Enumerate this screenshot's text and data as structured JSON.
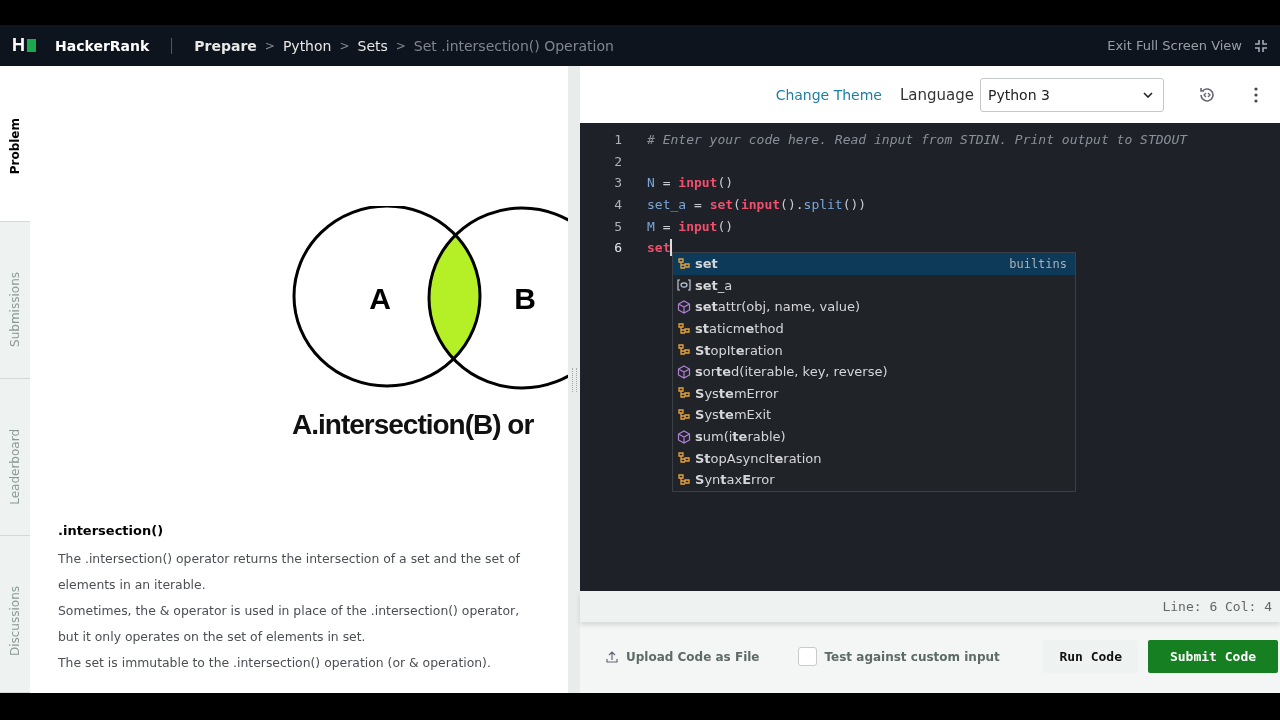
{
  "header": {
    "logo": "H",
    "brand": "HackerRank",
    "breadcrumbs": [
      {
        "label": "Prepare",
        "current": false,
        "strong": true
      },
      {
        "label": "Python",
        "current": false,
        "strong": false
      },
      {
        "label": "Sets",
        "current": false,
        "strong": false
      },
      {
        "label": "Set .intersection() Operation",
        "current": true,
        "strong": false
      }
    ],
    "separator": ">",
    "exit": "Exit Full Screen View"
  },
  "side_tabs": [
    {
      "label": "Problem",
      "selected": true
    },
    {
      "label": "Submissions",
      "selected": false
    },
    {
      "label": "Leaderboard",
      "selected": false
    },
    {
      "label": "Discussions",
      "selected": false
    }
  ],
  "problem": {
    "figure": {
      "left_label": "A",
      "right_label": "B",
      "caption": "A.intersection(B) or"
    },
    "heading": ".intersection()",
    "paragraphs": [
      "The .intersection() operator returns the intersection of a set and the set of elements in an iterable.",
      "Sometimes, the & operator is used in place of the .intersection() operator, but it only operates on the set of elements in set.",
      "The set is immutable to the .intersection() operation (or & operation)."
    ]
  },
  "toolbar": {
    "theme_link": "Change Theme",
    "language_label": "Language",
    "language": "Python 3"
  },
  "editor": {
    "lines": [
      {
        "number": "1",
        "cursor": false,
        "tokens": [
          {
            "text": "# Enter your code here. Read input from STDIN. Print output to STDOUT",
            "kind": "comment"
          }
        ]
      },
      {
        "number": "2",
        "cursor": false
      },
      {
        "number": "3",
        "cursor": false,
        "tokens": [
          {
            "text": "N",
            "kind": "name"
          },
          {
            "text": " = ",
            "kind": "op"
          },
          {
            "text": "input",
            "kind": "builtin"
          },
          {
            "text": "()",
            "kind": "punct"
          }
        ]
      },
      {
        "number": "4",
        "cursor": false,
        "tokens": [
          {
            "text": "set_a",
            "kind": "name"
          },
          {
            "text": " = ",
            "kind": "op"
          },
          {
            "text": "set",
            "kind": "builtin"
          },
          {
            "text": "(",
            "kind": "punct"
          },
          {
            "text": "input",
            "kind": "builtin"
          },
          {
            "text": "().",
            "kind": "punct"
          },
          {
            "text": "split",
            "kind": "method"
          },
          {
            "text": "())",
            "kind": "punct"
          }
        ]
      },
      {
        "number": "5",
        "cursor": false,
        "tokens": [
          {
            "text": "M",
            "kind": "name"
          },
          {
            "text": " = ",
            "kind": "op"
          },
          {
            "text": "input",
            "kind": "builtin"
          },
          {
            "text": "()",
            "kind": "punct"
          }
        ]
      },
      {
        "number": "6",
        "cursor": true,
        "tokens": [
          {
            "text": "set",
            "kind": "builtin"
          }
        ]
      }
    ],
    "autocomplete": [
      {
        "kind": "class",
        "label": "**set**",
        "detail": "builtins",
        "selected": true
      },
      {
        "kind": "variable",
        "label": "**set**_a",
        "selected": false
      },
      {
        "kind": "function",
        "label": "**set**attr(obj, name, value)",
        "selected": false
      },
      {
        "kind": "class",
        "label": "**st**aticm**e**thod",
        "selected": false
      },
      {
        "kind": "class",
        "label": "**St**opIt**e**ration",
        "selected": false
      },
      {
        "kind": "function",
        "label": "**s**or**te**d(iterable, key, reverse)",
        "selected": false
      },
      {
        "kind": "class",
        "label": "**S**ys**te**mError",
        "selected": false
      },
      {
        "kind": "class",
        "label": "**S**ys**te**mExit",
        "selected": false
      },
      {
        "kind": "function",
        "label": "**s**um(i**te**rable)",
        "selected": false
      },
      {
        "kind": "class",
        "label": "**St**opAsyncIt**e**ration",
        "selected": false
      },
      {
        "kind": "class",
        "label": "**S**yn**t**ax**E**rror",
        "selected": false
      }
    ]
  },
  "status": "Line: 6 Col: 4",
  "actions": {
    "upload": "Upload Code as File",
    "custom_input": {
      "label": "Test against custom input",
      "checked": false
    },
    "run": "Run Code",
    "submit": "Submit Code"
  }
}
